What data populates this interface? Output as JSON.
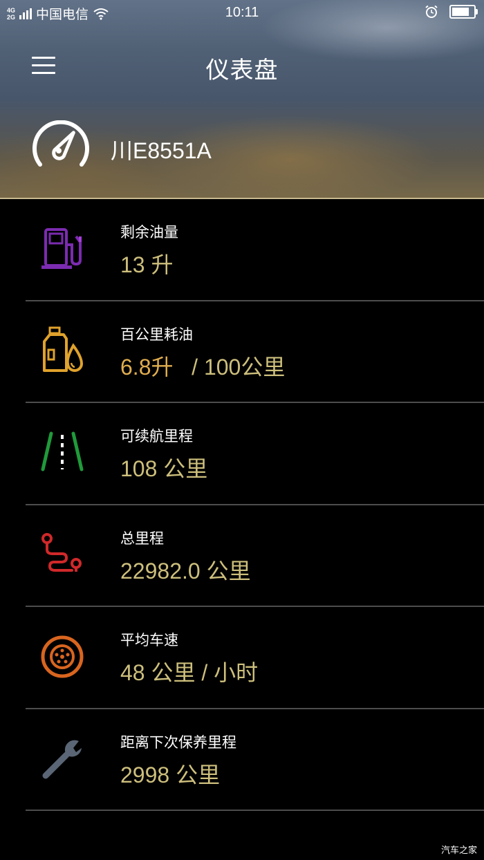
{
  "status_bar": {
    "network_top": "4G",
    "network_bottom": "2G",
    "carrier": "中国电信",
    "time": "10:11",
    "battery_level": 0.8
  },
  "header": {
    "menu_icon": "hamburger-menu-icon",
    "title": "仪表盘",
    "gauge_icon": "speedometer-icon",
    "plate": "川E8551A"
  },
  "colors": {
    "value_gold": "#cdbf7c",
    "fuel_icon": "#7b2bb0",
    "consumption_icon": "#e0a22c",
    "range_icon": "#1f9a3a",
    "mileage_icon": "#d0282a",
    "speed_icon": "#d9651f",
    "maintenance_icon": "#5a6675"
  },
  "items": [
    {
      "icon": "fuel-pump-icon",
      "label": "剩余油量",
      "value": "13 升"
    },
    {
      "icon": "oil-can-icon",
      "label": "百公里耗油",
      "value_main": "6.8升",
      "value_rest": "   / 100公里"
    },
    {
      "icon": "road-icon",
      "label": "可续航里程",
      "value": "108 公里"
    },
    {
      "icon": "route-icon",
      "label": "总里程",
      "value": "22982.0 公里"
    },
    {
      "icon": "tire-icon",
      "label": "平均车速",
      "value": "48 公里 / 小时"
    },
    {
      "icon": "wrench-icon",
      "label": "距离下次保养里程",
      "value": "2998 公里"
    }
  ],
  "watermark": "汽车之家"
}
